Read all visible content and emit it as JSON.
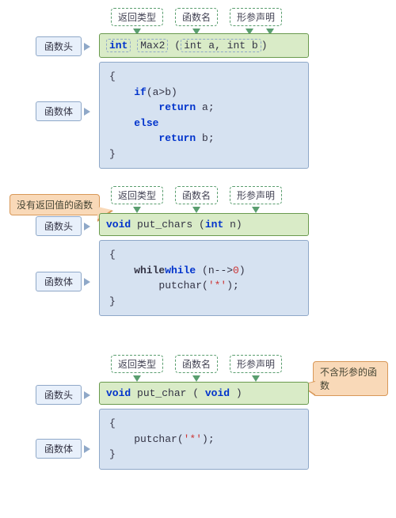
{
  "labels": {
    "return_type": "返回类型",
    "func_name": "函数名",
    "param_decl": "形参声明",
    "func_head": "函数头",
    "func_body": "函数体",
    "no_return": "没有返回值的函数",
    "no_param": "不含形参的函数"
  },
  "sec1": {
    "ret": "int",
    "name": "Max2",
    "paren_open": "(",
    "params": "int a, int b",
    "paren_close": ")",
    "body_l1": "{",
    "body_l2": "    if(a>b)",
    "body_l3": "        return a;",
    "body_l4": "    else",
    "body_l5": "        return b;",
    "body_l6": "}"
  },
  "sec2": {
    "head_pre": "void",
    "head_name": " put_chars ",
    "head_params": "(int n)",
    "body_l1": "{",
    "body_l2a": "    while",
    "body_l2b": " (n-->",
    "body_l2c": "0",
    "body_l2d": ")",
    "body_l3a": "        putchar(",
    "body_l3b": "'*'",
    "body_l3c": ");",
    "body_l4": "}"
  },
  "sec3": {
    "head_pre": "void",
    "head_name": "  put_char ",
    "head_open": "( ",
    "head_param": "void",
    "head_close": " )",
    "body_l1": "{",
    "body_l2a": "    putchar(",
    "body_l2b": "'*'",
    "body_l2c": ");",
    "body_l3": "}"
  }
}
